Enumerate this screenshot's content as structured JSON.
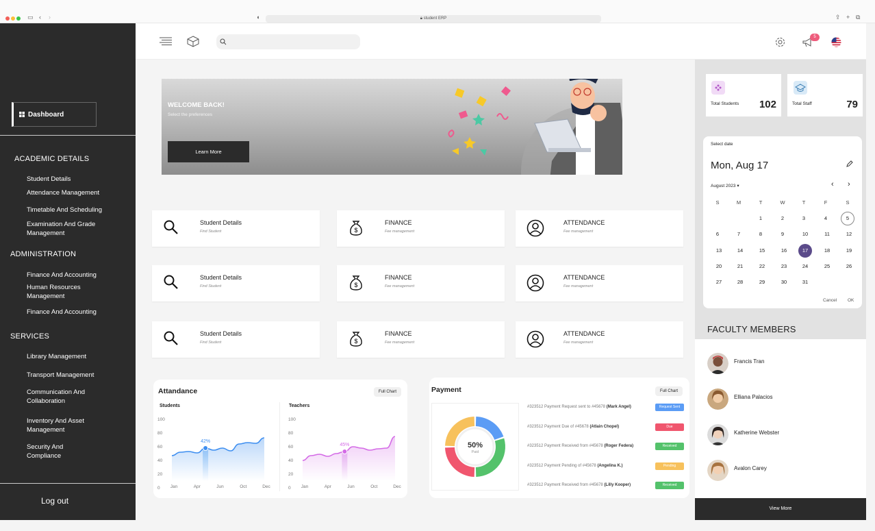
{
  "browser": {
    "url": "student ERP"
  },
  "sidebar": {
    "dashboard": "Dashboard",
    "sections": [
      {
        "title": "ACADEMIC DETAILS",
        "items": [
          "Student Details",
          "Attendance Management",
          "Timetable And Scheduling",
          "Examination And Grade Management"
        ]
      },
      {
        "title": "ADMINISTRATION",
        "items": [
          "Finance And Accounting",
          "Human Resources Management",
          "Finance And Accounting"
        ]
      },
      {
        "title": "SERVICES",
        "items": [
          "Library Management",
          "Transport Management",
          "Communication And Collaboration",
          "Inventory And Asset Management",
          "Security And Compliance"
        ]
      }
    ],
    "logout": "Log out"
  },
  "topbar": {
    "notification_count": "5"
  },
  "banner": {
    "title": "WELCOME BACK!",
    "subtitle": "Select the preferences",
    "button": "Learn More"
  },
  "cards": [
    {
      "title": "Student Details",
      "subtitle": "Find Student",
      "icon": "search-icon"
    },
    {
      "title": "FINANCE",
      "subtitle": "Fee management",
      "icon": "money-bag-icon"
    },
    {
      "title": "ATTENDANCE",
      "subtitle": "Fee management",
      "icon": "user-circle-icon"
    },
    {
      "title": "Student Details",
      "subtitle": "Find Student",
      "icon": "search-icon"
    },
    {
      "title": "FINANCE",
      "subtitle": "Fee management",
      "icon": "money-bag-icon"
    },
    {
      "title": "ATTENDANCE",
      "subtitle": "Fee management",
      "icon": "user-circle-icon"
    },
    {
      "title": "Student Details",
      "subtitle": "Find Student",
      "icon": "search-icon"
    },
    {
      "title": "FINANCE",
      "subtitle": "Fee management",
      "icon": "money-bag-icon"
    },
    {
      "title": "ATTENDANCE",
      "subtitle": "Fee management",
      "icon": "user-circle-icon"
    }
  ],
  "attendance": {
    "title": "Attandance",
    "full_chart": "Full Chart",
    "students_label": "Students",
    "teachers_label": "Teachers",
    "students_highlight": "42%",
    "teachers_highlight": "45%"
  },
  "payment": {
    "title": "Payment",
    "full_chart": "Full Chart",
    "donut_value": "50%",
    "donut_label": "Paid",
    "rows": [
      {
        "prefix": "#323512 Payment Request sent to",
        "ref": "#45678",
        "name": "(Mark Angel)",
        "status": "Request Sent",
        "color": "#5b9cf5"
      },
      {
        "prefix": "#323512 Payment Due of",
        "ref": "#45678",
        "name": "(Atlain Chopel)",
        "status": "Due",
        "color": "#f0566e"
      },
      {
        "prefix": "#323512 Payment Received from",
        "ref": "#45678",
        "name": "(Roger Federa)",
        "status": "Received",
        "color": "#54c26b"
      },
      {
        "prefix": "#323512 Payment Pending of",
        "ref": "#45678",
        "name": "(Angelina K.)",
        "status": "Pending",
        "color": "#f7c15c"
      },
      {
        "prefix": "#323512 Payment Received from",
        "ref": "#45678",
        "name": "(Lilly Kooper)",
        "status": "Received",
        "color": "#54c26b"
      }
    ]
  },
  "stats": [
    {
      "label": "Total Students",
      "value": "102"
    },
    {
      "label": "Total Staff",
      "value": "79"
    }
  ],
  "calendar": {
    "select_label": "Select date",
    "display_date": "Mon, Aug 17",
    "month_label": "August 2023",
    "weekdays": [
      "S",
      "M",
      "T",
      "W",
      "T",
      "F",
      "S"
    ],
    "weeks": [
      [
        "",
        "",
        "1",
        "2",
        "3",
        "4",
        "5"
      ],
      [
        "6",
        "7",
        "8",
        "9",
        "10",
        "11",
        "12"
      ],
      [
        "13",
        "14",
        "15",
        "16",
        "17",
        "18",
        "19"
      ],
      [
        "20",
        "21",
        "22",
        "23",
        "24",
        "25",
        "26"
      ],
      [
        "27",
        "28",
        "29",
        "30",
        "31",
        "",
        ""
      ]
    ],
    "selected_day": "17",
    "today_day": "5",
    "cancel": "Cancel",
    "ok": "OK"
  },
  "faculty": {
    "title": "FACULTY MEMBERS",
    "members": [
      "Francis Tran",
      "Elliana Palacios",
      "Katherine Webster",
      "Avalon Carey"
    ],
    "view_more": "View More"
  },
  "chart_data": [
    {
      "type": "area",
      "title": "Students",
      "categories": [
        "Jan",
        "Apr",
        "Jun",
        "Oct",
        "Dec"
      ],
      "x": [
        0,
        1,
        2,
        3,
        4,
        5,
        6,
        7,
        8,
        9,
        10,
        11
      ],
      "values": [
        47,
        52,
        53,
        51,
        58,
        55,
        58,
        54,
        64,
        66,
        65,
        73
      ],
      "ylim": [
        0,
        100
      ],
      "yticks": [
        0,
        20,
        40,
        60,
        80,
        100
      ],
      "highlight": {
        "index": 4,
        "label": "42%"
      }
    },
    {
      "type": "area",
      "title": "Teachers",
      "categories": [
        "Jan",
        "Apr",
        "Jun",
        "Oct",
        "Dec"
      ],
      "x": [
        0,
        1,
        2,
        3,
        4,
        5,
        6,
        7,
        8,
        9,
        10,
        11
      ],
      "values": [
        40,
        47,
        49,
        46,
        50,
        53,
        60,
        58,
        55,
        57,
        58,
        75
      ],
      "ylim": [
        0,
        100
      ],
      "yticks": [
        0,
        20,
        40,
        60,
        80,
        100
      ],
      "highlight": {
        "index": 5,
        "label": "45%"
      }
    },
    {
      "type": "pie",
      "title": "Payment",
      "center_label": "50%",
      "slices": [
        {
          "name": "Request Sent",
          "value": 20,
          "color": "#5b9cf5"
        },
        {
          "name": "Received",
          "value": 30,
          "color": "#54c26b"
        },
        {
          "name": "Due",
          "value": 25,
          "color": "#f0566e"
        },
        {
          "name": "Pending",
          "value": 25,
          "color": "#f7c15c"
        }
      ]
    }
  ]
}
